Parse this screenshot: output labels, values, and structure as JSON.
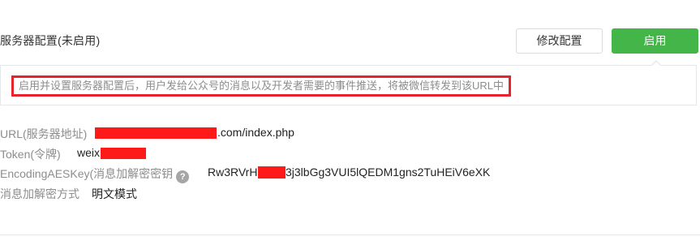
{
  "section": {
    "title": "服务器配置(未启用)"
  },
  "buttons": {
    "modify_label": "修改配置",
    "enable_label": "启用"
  },
  "tip": {
    "text": "启用并设置服务器配置后，用户发给公众号的消息以及开发者需要的事件推送，将被微信转发到该URL中"
  },
  "config": {
    "url": {
      "label": "URL(服务器地址)",
      "value_visible": ".com/index.php"
    },
    "token": {
      "label": "Token(令牌)",
      "value_visible": "weix"
    },
    "aes_key": {
      "label": "EncodingAESKey(消息加解密密钥",
      "help_glyph": "?",
      "value_prefix": "Rw3RVrHl",
      "value_suffix": "3j3lbGg3VUI5lQEDM1gns2TuHEiV6eXK"
    },
    "encrypt_mode": {
      "label": "消息加解密方式",
      "value": "明文模式"
    }
  },
  "colors": {
    "primary_green": "#44b549",
    "redaction_red": "#ff1a1a",
    "highlight_border": "#e8232d",
    "muted_text": "#8d8d8d"
  },
  "icons": {
    "help": "question-circle-icon"
  }
}
